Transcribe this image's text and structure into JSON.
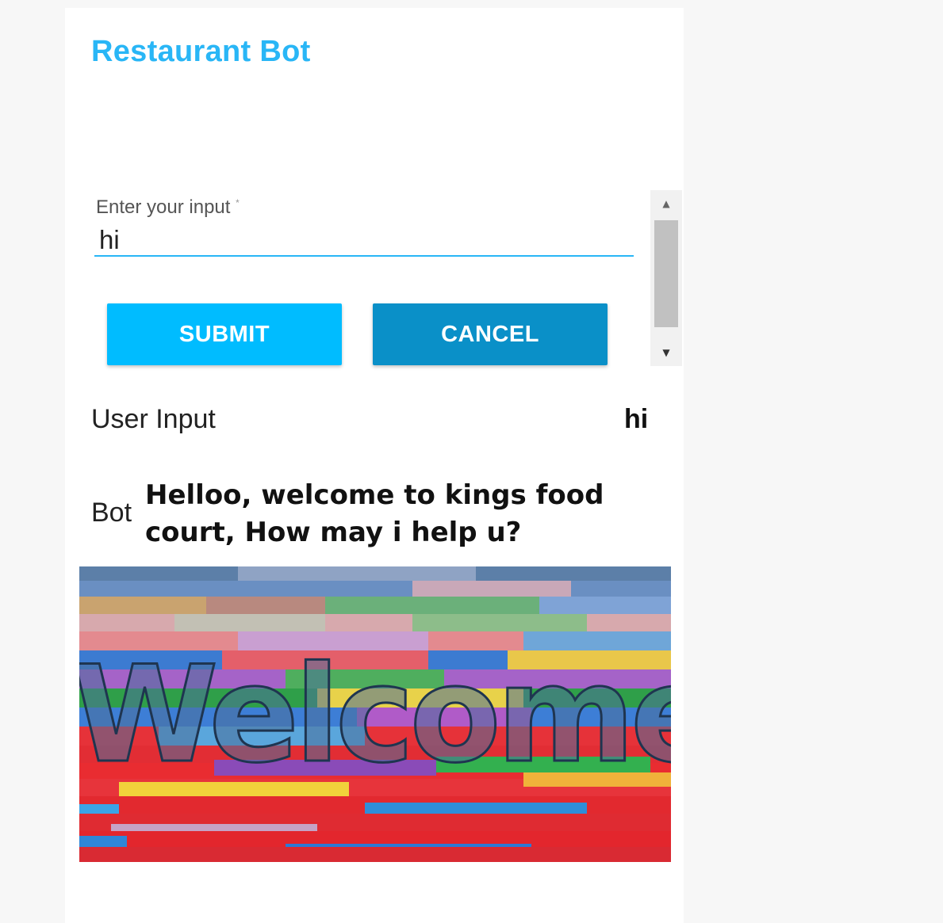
{
  "app": {
    "title": "Restaurant Bot"
  },
  "form": {
    "label": "Enter your input",
    "required_mark": "*",
    "value": "hi",
    "submit_label": "SUBMIT",
    "cancel_label": "CANCEL"
  },
  "scrollbar": {
    "up_icon": "scroll-up-arrow",
    "down_icon": "scroll-down-arrow"
  },
  "conversation": {
    "user_label": "User Input",
    "user_value": "hi",
    "bot_label": "Bot",
    "bot_value": "Helloo, welcome to kings food court, How may i help u?"
  },
  "banner": {
    "image": "welcome-sign on multicolored wooden planks",
    "text": "Welcome"
  },
  "colors": {
    "accent": "#29b6f6",
    "submit": "#00bcff",
    "cancel": "#0a90c8"
  }
}
